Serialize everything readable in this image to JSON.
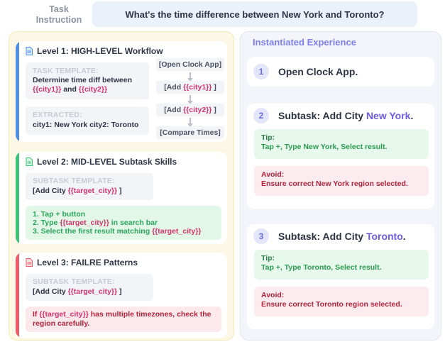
{
  "task": {
    "label_line1": "Task",
    "label_line2": "Instruction",
    "text": "What's the time difference between New York and Toronto?"
  },
  "level1": {
    "title": "Level 1: HIGH-LEVEL Workflow",
    "template_label": "TASK TEMPLATE:",
    "template_text": "Determine time diff between",
    "city1": "{{city1}}",
    "and": "and",
    "city2": "{{city2}}",
    "extracted_label": "EXTRACTED:",
    "extracted_text": "city1: New York  city2: Toronto",
    "flow": {
      "step1": "[Open Clock App]",
      "step2_pre": "[Add",
      "step2_var": "{{city1}}",
      "step2_post": "]",
      "step3_pre": "[Add",
      "step3_var": "{{city2}}",
      "step3_post": "]",
      "step4": "[Compare Times]"
    }
  },
  "level2": {
    "title": "Level 2: MID-LEVEL Subtask Skills",
    "template_label": "SUBTASK TEMPLATE:",
    "template_pre": "[Add City",
    "template_var": "{{target_city}}",
    "template_post": "]",
    "step1": "1. Tap + button",
    "step2_pre": "2. Type",
    "step2_var": "{{target_city}}",
    "step2_post": "in search bar",
    "step3_pre": "3. Select the first result matching",
    "step3_var": "{{target_city}}"
  },
  "level3": {
    "title": "Level 3: FAILRE Patterns",
    "template_label": "SUBTASK TEMPLATE:",
    "template_pre": "[Add City",
    "template_var": "{{target_city}}",
    "template_post": "]",
    "warn_pre": "If",
    "warn_var": "{{target_city}}",
    "warn_post": "has multiple timezones, check the",
    "warn_line2": "region carefully."
  },
  "experience": {
    "title": "Instantiated Experience",
    "step1": {
      "num": "1",
      "title": "Open Clock App."
    },
    "step2": {
      "num": "2",
      "title_pre": "Subtask: Add City",
      "city": "New York",
      "title_post": ".",
      "tip_label": "Tip:",
      "tip_text": "Tap +, Type New York, Select result.",
      "avoid_label": "Avoid:",
      "avoid_text": "Ensure correct New York region selected."
    },
    "step3": {
      "num": "3",
      "title_pre": "Subtask: Add City",
      "city": "Toronto",
      "title_post": ".",
      "tip_label": "Tip:",
      "tip_text": "Tap +, Type Toronto, Select result.",
      "avoid_label": "Avoid:",
      "avoid_text": "Ensure correct Toronto region selected."
    }
  },
  "colors": {
    "level1_accent": "#4f8fe6",
    "level2_accent": "#3ec277",
    "level3_accent": "#ef5a6a",
    "variable": "#d6336c",
    "city_highlight": "#6b5ce7"
  }
}
